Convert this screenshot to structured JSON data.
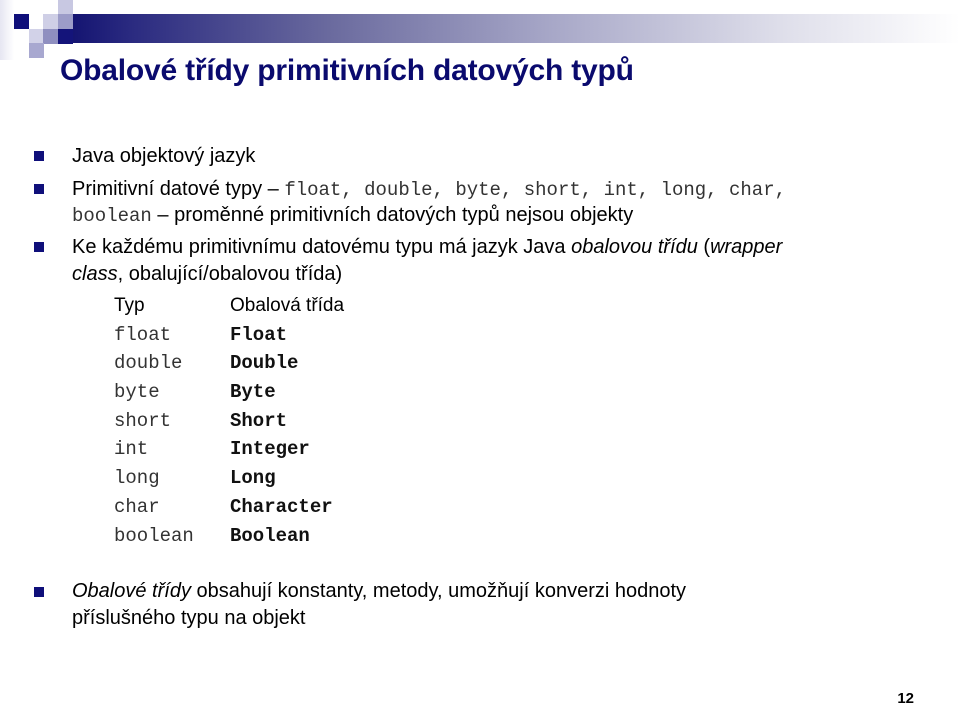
{
  "slide": {
    "title": "Obalové třídy primitivních datových typů",
    "page_number": "12",
    "accent_color": "#0a0a6e",
    "bullet_color": "#0f0f7a",
    "bullet_icon": "square-bullet-icon"
  },
  "bullets": [
    {
      "text": "Java objektový jazyk"
    },
    {
      "prefix": "Primitivní datové typy – ",
      "types_line1": "float, double, byte, short, int, long, char,",
      "types_line2": "boolean",
      "suffix": " – proměnné primitivních datových typů nejsou objekty"
    },
    {
      "part1": "Ke každému primitivnímu datovému typu má jazyk Java ",
      "italic1": "obalovou třídu",
      "part2": " (",
      "italic2": "wrapper",
      "italic3": "class",
      "part3": ", obalující/obalovou třída)"
    },
    {
      "italic": "Obalové třídy",
      "line1_rest": " obsahují konstanty, metody, umožňují konverzi hodnoty",
      "line2": "příslušného typu na objekt"
    }
  ],
  "wrapper_table": {
    "headers": [
      "Typ",
      "Obalová třída"
    ],
    "rows": [
      [
        "float",
        "Float"
      ],
      [
        "double",
        "Double"
      ],
      [
        "byte",
        "Byte"
      ],
      [
        "short",
        "Short"
      ],
      [
        "int",
        "Integer"
      ],
      [
        "long",
        "Long"
      ],
      [
        "char",
        "Character"
      ],
      [
        "boolean",
        "Boolean"
      ]
    ]
  }
}
